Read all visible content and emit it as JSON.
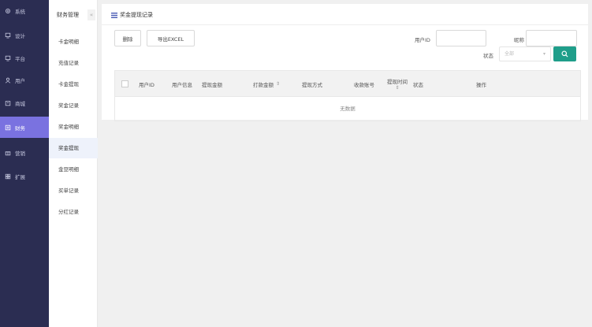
{
  "nav": {
    "items": [
      {
        "label": "系统",
        "icon": "gear-icon"
      },
      {
        "label": "设计",
        "icon": "monitor-icon"
      },
      {
        "label": "平台",
        "icon": "monitor-icon"
      },
      {
        "label": "用户",
        "icon": "user-icon"
      },
      {
        "label": "商城",
        "icon": "shop-icon"
      },
      {
        "label": "财务",
        "icon": "finance-icon"
      },
      {
        "label": "营销",
        "icon": "gift-icon"
      },
      {
        "label": "扩展",
        "icon": "grid-icon"
      }
    ],
    "active_index": 5,
    "active_color": "#7a72e0",
    "background": "#2b2d52"
  },
  "submenu": {
    "title": "财务管理",
    "collapse_glyph": "«",
    "items": [
      "卡金明细",
      "充值记录",
      "卡金提现",
      "奖金记录",
      "奖金明细",
      "奖金提现",
      "金豆明细",
      "买单记录",
      "分红记录"
    ],
    "active_index": 5
  },
  "page": {
    "title": "奖金提现记录",
    "delete_label": "删除",
    "export_label": "导出EXCEL",
    "filters": {
      "user_id_label": "用户ID",
      "nickname_label": "昵称",
      "status_label": "状态",
      "status_placeholder": "全部"
    },
    "accent_color": "#1f9e8a"
  },
  "table": {
    "columns": [
      {
        "label": "用户ID",
        "sortable": false
      },
      {
        "label": "用户信息",
        "sortable": false
      },
      {
        "label": "提现金额",
        "sortable": false
      },
      {
        "label": "打款金额",
        "sortable": true
      },
      {
        "label": "提现方式",
        "sortable": false
      },
      {
        "label": "收款账号",
        "sortable": false
      },
      {
        "label": "提现时间",
        "sortable": true
      },
      {
        "label": "状态",
        "sortable": false
      },
      {
        "label": "操作",
        "sortable": false
      }
    ],
    "sort_glyph": "⇕",
    "empty_text": "无数据"
  }
}
